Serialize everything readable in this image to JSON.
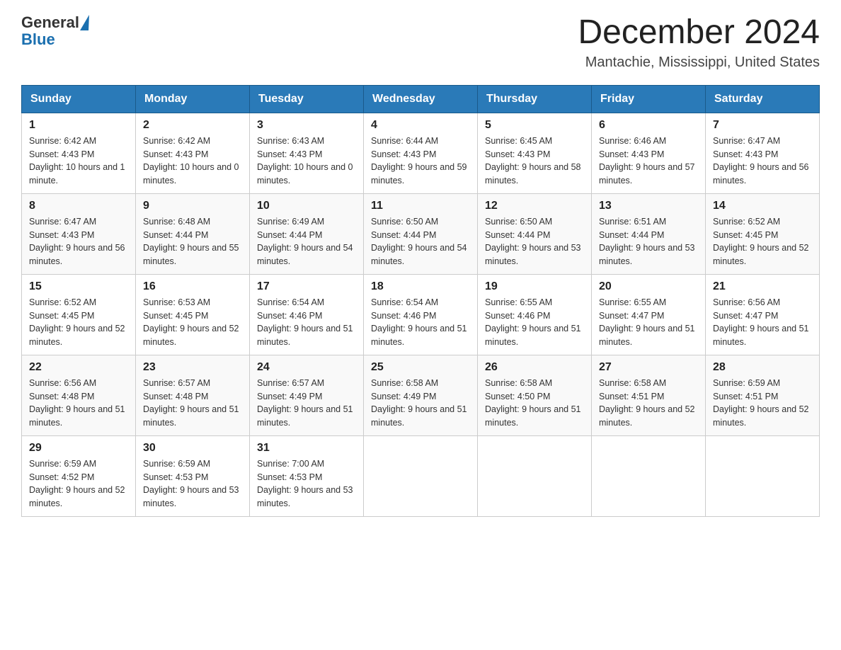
{
  "header": {
    "logo_general": "General",
    "logo_blue": "Blue",
    "month_title": "December 2024",
    "location": "Mantachie, Mississippi, United States"
  },
  "weekdays": [
    "Sunday",
    "Monday",
    "Tuesday",
    "Wednesday",
    "Thursday",
    "Friday",
    "Saturday"
  ],
  "weeks": [
    [
      {
        "day": "1",
        "sunrise": "6:42 AM",
        "sunset": "4:43 PM",
        "daylight": "10 hours and 1 minute."
      },
      {
        "day": "2",
        "sunrise": "6:42 AM",
        "sunset": "4:43 PM",
        "daylight": "10 hours and 0 minutes."
      },
      {
        "day": "3",
        "sunrise": "6:43 AM",
        "sunset": "4:43 PM",
        "daylight": "10 hours and 0 minutes."
      },
      {
        "day": "4",
        "sunrise": "6:44 AM",
        "sunset": "4:43 PM",
        "daylight": "9 hours and 59 minutes."
      },
      {
        "day": "5",
        "sunrise": "6:45 AM",
        "sunset": "4:43 PM",
        "daylight": "9 hours and 58 minutes."
      },
      {
        "day": "6",
        "sunrise": "6:46 AM",
        "sunset": "4:43 PM",
        "daylight": "9 hours and 57 minutes."
      },
      {
        "day": "7",
        "sunrise": "6:47 AM",
        "sunset": "4:43 PM",
        "daylight": "9 hours and 56 minutes."
      }
    ],
    [
      {
        "day": "8",
        "sunrise": "6:47 AM",
        "sunset": "4:43 PM",
        "daylight": "9 hours and 56 minutes."
      },
      {
        "day": "9",
        "sunrise": "6:48 AM",
        "sunset": "4:44 PM",
        "daylight": "9 hours and 55 minutes."
      },
      {
        "day": "10",
        "sunrise": "6:49 AM",
        "sunset": "4:44 PM",
        "daylight": "9 hours and 54 minutes."
      },
      {
        "day": "11",
        "sunrise": "6:50 AM",
        "sunset": "4:44 PM",
        "daylight": "9 hours and 54 minutes."
      },
      {
        "day": "12",
        "sunrise": "6:50 AM",
        "sunset": "4:44 PM",
        "daylight": "9 hours and 53 minutes."
      },
      {
        "day": "13",
        "sunrise": "6:51 AM",
        "sunset": "4:44 PM",
        "daylight": "9 hours and 53 minutes."
      },
      {
        "day": "14",
        "sunrise": "6:52 AM",
        "sunset": "4:45 PM",
        "daylight": "9 hours and 52 minutes."
      }
    ],
    [
      {
        "day": "15",
        "sunrise": "6:52 AM",
        "sunset": "4:45 PM",
        "daylight": "9 hours and 52 minutes."
      },
      {
        "day": "16",
        "sunrise": "6:53 AM",
        "sunset": "4:45 PM",
        "daylight": "9 hours and 52 minutes."
      },
      {
        "day": "17",
        "sunrise": "6:54 AM",
        "sunset": "4:46 PM",
        "daylight": "9 hours and 51 minutes."
      },
      {
        "day": "18",
        "sunrise": "6:54 AM",
        "sunset": "4:46 PM",
        "daylight": "9 hours and 51 minutes."
      },
      {
        "day": "19",
        "sunrise": "6:55 AM",
        "sunset": "4:46 PM",
        "daylight": "9 hours and 51 minutes."
      },
      {
        "day": "20",
        "sunrise": "6:55 AM",
        "sunset": "4:47 PM",
        "daylight": "9 hours and 51 minutes."
      },
      {
        "day": "21",
        "sunrise": "6:56 AM",
        "sunset": "4:47 PM",
        "daylight": "9 hours and 51 minutes."
      }
    ],
    [
      {
        "day": "22",
        "sunrise": "6:56 AM",
        "sunset": "4:48 PM",
        "daylight": "9 hours and 51 minutes."
      },
      {
        "day": "23",
        "sunrise": "6:57 AM",
        "sunset": "4:48 PM",
        "daylight": "9 hours and 51 minutes."
      },
      {
        "day": "24",
        "sunrise": "6:57 AM",
        "sunset": "4:49 PM",
        "daylight": "9 hours and 51 minutes."
      },
      {
        "day": "25",
        "sunrise": "6:58 AM",
        "sunset": "4:49 PM",
        "daylight": "9 hours and 51 minutes."
      },
      {
        "day": "26",
        "sunrise": "6:58 AM",
        "sunset": "4:50 PM",
        "daylight": "9 hours and 51 minutes."
      },
      {
        "day": "27",
        "sunrise": "6:58 AM",
        "sunset": "4:51 PM",
        "daylight": "9 hours and 52 minutes."
      },
      {
        "day": "28",
        "sunrise": "6:59 AM",
        "sunset": "4:51 PM",
        "daylight": "9 hours and 52 minutes."
      }
    ],
    [
      {
        "day": "29",
        "sunrise": "6:59 AM",
        "sunset": "4:52 PM",
        "daylight": "9 hours and 52 minutes."
      },
      {
        "day": "30",
        "sunrise": "6:59 AM",
        "sunset": "4:53 PM",
        "daylight": "9 hours and 53 minutes."
      },
      {
        "day": "31",
        "sunrise": "7:00 AM",
        "sunset": "4:53 PM",
        "daylight": "9 hours and 53 minutes."
      },
      null,
      null,
      null,
      null
    ]
  ]
}
